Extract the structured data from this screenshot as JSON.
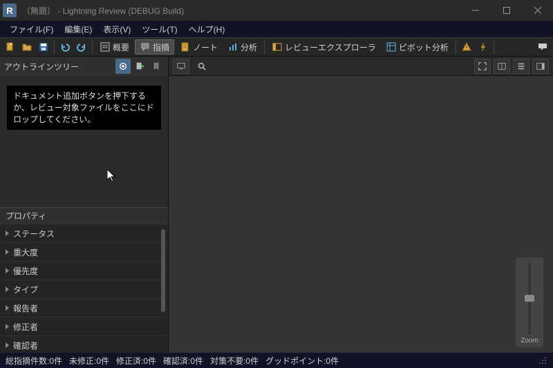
{
  "titlebar": {
    "logo_text": "R",
    "title": "（無題） - Lightning Review (DEBUG Build)"
  },
  "menubar": {
    "items": [
      {
        "label": "ファイル(F)"
      },
      {
        "label": "編集(E)"
      },
      {
        "label": "表示(V)"
      },
      {
        "label": "ツール(T)"
      },
      {
        "label": "ヘルプ(H)"
      }
    ]
  },
  "toolbar": {
    "overview_label": "概要",
    "point_label": "指摘",
    "note_label": "ノート",
    "analysis_label": "分析",
    "review_explorer_label": "レビューエクスプローラ",
    "pivot_label": "ピボット分析"
  },
  "outline": {
    "title": "アウトラインツリー",
    "drop_message": "ドキュメント追加ボタンを押下するか、レビュー対象ファイルをここにドロップしてください。"
  },
  "properties": {
    "title": "プロパティ",
    "rows": [
      {
        "label": "ステータス"
      },
      {
        "label": "重大度"
      },
      {
        "label": "優先度"
      },
      {
        "label": "タイプ"
      },
      {
        "label": "報告者"
      },
      {
        "label": "修正者"
      },
      {
        "label": "確認者"
      }
    ]
  },
  "zoom": {
    "label": "Zoom"
  },
  "statusbar": {
    "total": "総指摘件数:0件",
    "unfixed": "未修正:0件",
    "fixed": "修正済:0件",
    "confirmed": "確認済:0件",
    "noaction": "対策不要:0件",
    "goodpoint": "グッドポイント:0件"
  },
  "colors": {
    "accent_blue": "#4a6a8a",
    "icon_yellow": "#d9a441",
    "icon_cyan": "#5fb3d9"
  }
}
